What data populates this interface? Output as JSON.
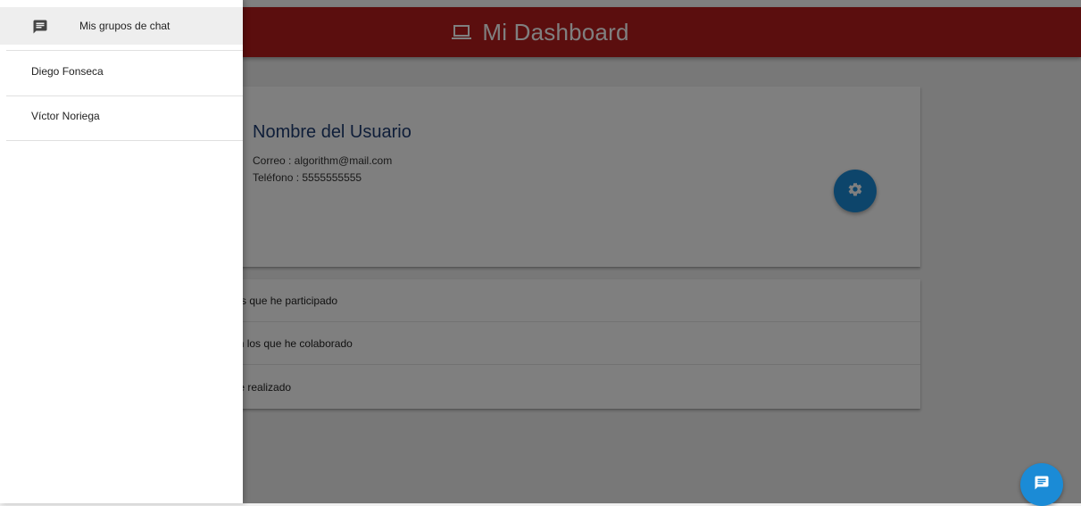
{
  "navbar": {
    "title": "Mi Dashboard",
    "icon": "laptop-icon",
    "color": "#b71c1c"
  },
  "profile": {
    "name": "Nombre del Usuario",
    "email": "Correo : algorithm@mail.com",
    "phone": "Teléfono : 5555555555",
    "settings_icon": "gear-icon"
  },
  "list": {
    "items": [
      {
        "label": "os en los que he participado"
      },
      {
        "label": "ectos en los que he colaborado"
      },
      {
        "label": "s que he realizado"
      }
    ]
  },
  "sidenav": {
    "header": {
      "icon": "chat-icon",
      "label": "Mis grupos de chat"
    },
    "items": [
      {
        "label": "Diego Fonseca"
      },
      {
        "label": "Víctor Noriega"
      }
    ]
  },
  "fab": {
    "icon": "chat-icon"
  },
  "colors": {
    "accent": "#1b8bd6",
    "header_bg": "#b71c1c"
  }
}
